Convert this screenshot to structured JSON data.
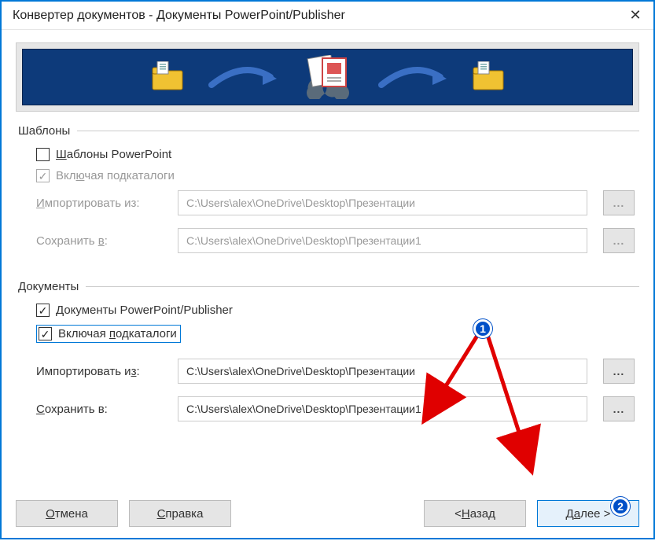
{
  "window": {
    "title": "Конвертер документов - Документы PowerPoint/Publisher",
    "close_glyph": "✕"
  },
  "groups": {
    "templates": {
      "legend": "Шаблоны",
      "chk1_label_pre": "",
      "chk1_label_ul": "Ш",
      "chk1_label_post": "аблоны PowerPoint",
      "chk2_label_pre": "Вкл",
      "chk2_label_ul": "ю",
      "chk2_label_post": "чая подкаталоги",
      "import_label_pre": "",
      "import_label_ul": "И",
      "import_label_post": "мпортировать из:",
      "import_value": "C:\\Users\\alex\\OneDrive\\Desktop\\Презентации",
      "save_label_pre": "Сохранить ",
      "save_label_ul": "в",
      "save_label_post": ":",
      "save_value": "C:\\Users\\alex\\OneDrive\\Desktop\\Презентации1",
      "browse_label": "..."
    },
    "documents": {
      "legend": "Документы",
      "chk1_label_pre": "",
      "chk1_label_ul": "Д",
      "chk1_label_post": "окументы PowerPoint/Publisher",
      "chk2_label_pre": "Включая ",
      "chk2_label_ul": "п",
      "chk2_label_post": "одкаталоги",
      "import_label_pre": "Импортировать и",
      "import_label_ul": "з",
      "import_label_post": ":",
      "import_value": "C:\\Users\\alex\\OneDrive\\Desktop\\Презентации",
      "save_label_pre": "",
      "save_label_ul": "С",
      "save_label_post": "охранить в:",
      "save_value": "C:\\Users\\alex\\OneDrive\\Desktop\\Презентации1",
      "browse_label": "..."
    }
  },
  "buttons": {
    "cancel_ul": "О",
    "cancel_post": "тмена",
    "help_ul": "С",
    "help_post": "правка",
    "back_pre": "< ",
    "back_ul": "Н",
    "back_post": "азад",
    "next_pre": "Д",
    "next_ul": "а",
    "next_post": "лее >"
  },
  "annotations": {
    "badge1": "1",
    "badge2": "2"
  }
}
